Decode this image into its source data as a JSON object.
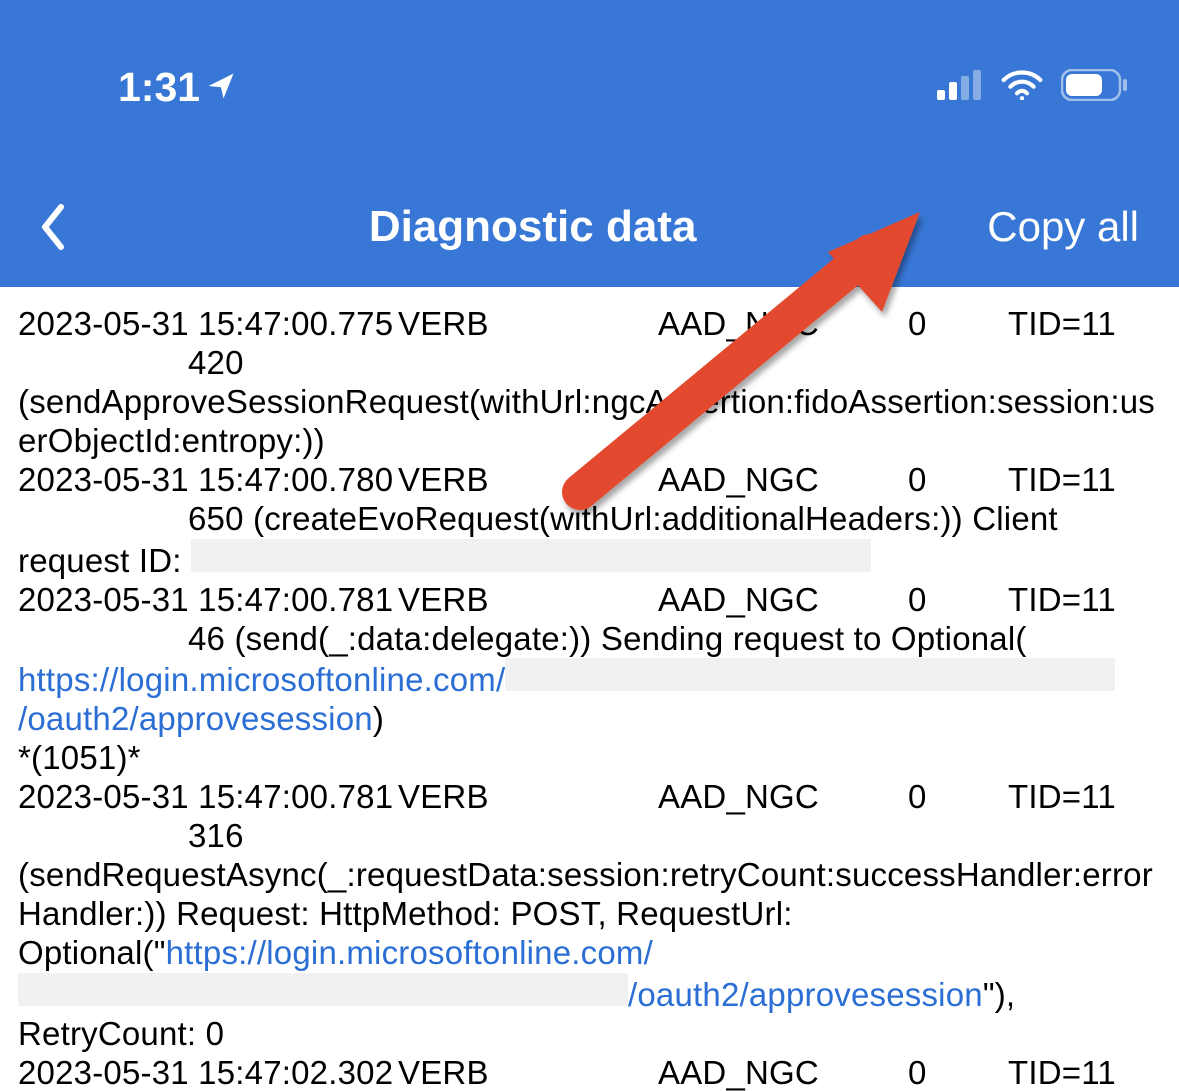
{
  "status": {
    "time": "1:31"
  },
  "nav": {
    "title": "Diagnostic data",
    "copy_all": "Copy all"
  },
  "logs": [
    {
      "ts": "2023-05-31 15:47:00.775",
      "level": "VERB",
      "tag": "AAD_NGC",
      "code": "0",
      "tid": "TID=11",
      "line2_indent": "420",
      "body": "(sendApproveSessionRequest(withUrl:ngcAssertion:fidoAssertion:session:userObjectId:entropy:))"
    },
    {
      "ts": "2023-05-31 15:47:00.780",
      "level": "VERB",
      "tag": "AAD_NGC",
      "code": "0",
      "tid": "TID=11",
      "line2_indent": "650 (createEvoRequest(withUrl:additionalHeaders:)) Client",
      "body_prefix": "request ID: "
    },
    {
      "ts": "2023-05-31 15:47:00.781",
      "level": "VERB",
      "tag": "AAD_NGC",
      "code": "0",
      "tid": "TID=11",
      "line2_indent": "46 (send(_:data:delegate:)) Sending request to Optional(",
      "link1": "https://login.microsoftonline.com/",
      "link2": "/oauth2/approvesession",
      "after_link": ")",
      "extra": "*(1051)*"
    },
    {
      "ts": "2023-05-31 15:47:00.781",
      "level": "VERB",
      "tag": "AAD_NGC",
      "code": "0",
      "tid": "TID=11",
      "line2_indent": "316",
      "body_line1": "(sendRequestAsync(_:requestData:session:retryCount:successHandler:errorHandler:)) Request: HttpMethod: POST, RequestUrl: Optional(\"",
      "link1": "https://login.microsoftonline.com/",
      "link2": "/oauth2/approvesession",
      "after_link": "\"), RetryCount: 0"
    },
    {
      "ts": "2023-05-31 15:47:02.302",
      "level": "VERB",
      "tag": "AAD_NGC",
      "code": "0",
      "tid": "TID=11"
    }
  ]
}
